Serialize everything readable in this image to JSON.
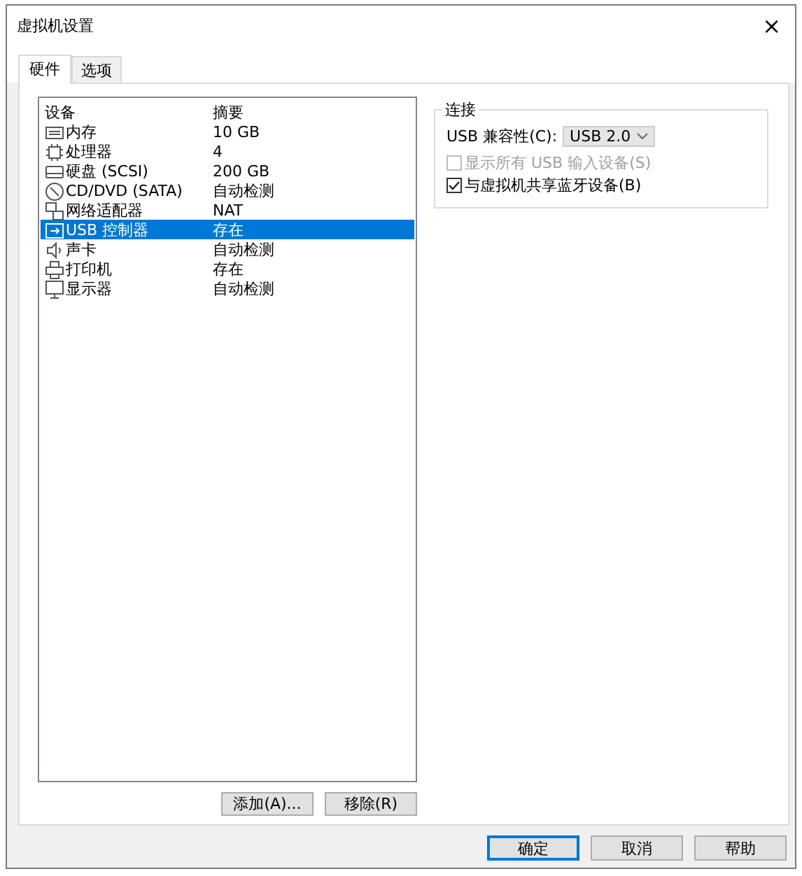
{
  "window": {
    "title": "虚拟机设置",
    "close": "×"
  },
  "tabs": [
    {
      "label": "硬件",
      "selected": true
    },
    {
      "label": "选项",
      "selected": false
    }
  ],
  "device_list": {
    "columns": [
      "设备",
      "摘要"
    ],
    "rows": [
      {
        "kind": "memory",
        "device": "内存",
        "summary": "10 GB",
        "selected": false
      },
      {
        "kind": "cpu",
        "device": "处理器",
        "summary": "4",
        "selected": false
      },
      {
        "kind": "disk",
        "device": "硬盘 (SCSI)",
        "summary": "200 GB",
        "selected": false
      },
      {
        "kind": "cd",
        "device": "CD/DVD (SATA)",
        "summary": "自动检测",
        "selected": false
      },
      {
        "kind": "network",
        "device": "网络适配器",
        "summary": "NAT",
        "selected": false
      },
      {
        "kind": "usb",
        "device": "USB 控制器",
        "summary": "存在",
        "selected": true
      },
      {
        "kind": "sound",
        "device": "声卡",
        "summary": "自动检测",
        "selected": false
      },
      {
        "kind": "printer",
        "device": "打印机",
        "summary": "存在",
        "selected": false
      },
      {
        "kind": "display",
        "device": "显示器",
        "summary": "自动检测",
        "selected": false
      }
    ]
  },
  "list_buttons": [
    "添加(A)...",
    "移除(R)"
  ],
  "connection": {
    "title": "连接",
    "compat_label": "USB 兼容性(C):",
    "compat_value": "USB 2.0",
    "options": [
      {
        "label": "显示所有 USB 输入设备(S)",
        "checked": false,
        "disabled": true
      },
      {
        "label": "与虚拟机共享蓝牙设备(B)",
        "checked": true,
        "disabled": false
      }
    ]
  },
  "footer_buttons": [
    {
      "label": "确定",
      "default": true
    },
    {
      "label": "取消",
      "default": false
    },
    {
      "label": "帮助",
      "default": false
    }
  ]
}
